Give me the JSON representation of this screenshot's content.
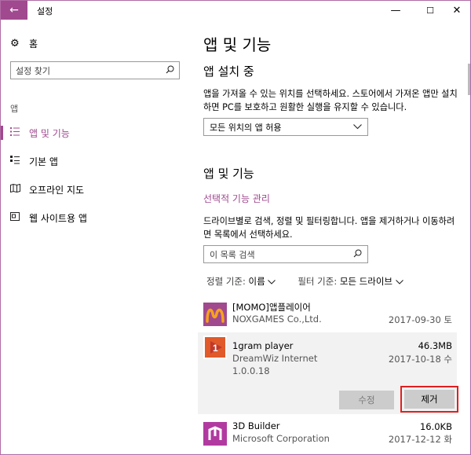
{
  "window": {
    "title": "설정",
    "back_glyph": "←",
    "min_glyph": "—",
    "max_glyph": "☐",
    "close_glyph": "✕"
  },
  "sidebar": {
    "home_label": "홈",
    "search_placeholder": "설정 찾기",
    "section_label": "앱",
    "items": [
      {
        "label": "앱 및 기능",
        "icon": "list-icon",
        "active": true
      },
      {
        "label": "기본 앱",
        "icon": "default-apps-icon",
        "active": false
      },
      {
        "label": "오프라인 지도",
        "icon": "map-icon",
        "active": false
      },
      {
        "label": "웹 사이트용 앱",
        "icon": "website-apps-icon",
        "active": false
      }
    ]
  },
  "main": {
    "title": "앱 및 기능",
    "install_heading": "앱 설치 중",
    "install_desc": "앱을 가져올 수 있는 위치를 선택하세요. 스토어에서 가져온 앱만 설치하면 PC를 보호하고 원활한 실행을 유지할 수 있습니다.",
    "install_dropdown": "모든 위치의 앱 허용",
    "apps_heading": "앱 및 기능",
    "optional_features_link": "선택적 기능 관리",
    "apps_desc": "드라이브별로 검색, 정렬 및 필터링합니다. 앱을 제거하거나 이동하려면 목록에서 선택하세요.",
    "list_search_placeholder": "이 목록 검색",
    "sort_label": "정렬 기준:",
    "sort_value": "이름",
    "filter_label": "필터 기준:",
    "filter_value": "모든 드라이브",
    "apps": [
      {
        "name": "[MOMO]앱플레이어",
        "publisher": "NOXGAMES Co.,Ltd.",
        "size": "",
        "date": "2017-09-30 토",
        "version": ""
      },
      {
        "name": "1gram player",
        "publisher": "DreamWiz Internet",
        "size": "46.3MB",
        "date": "2017-10-18 수",
        "version": "1.0.0.18"
      },
      {
        "name": "3D Builder",
        "publisher": "Microsoft Corporation",
        "size": "16.0KB",
        "date": "2017-12-12 화",
        "version": ""
      }
    ],
    "modify_button": "수정",
    "uninstall_button": "제거"
  },
  "colors": {
    "accent": "#a0498f",
    "highlight_border": "#e02020",
    "momo_icon": "#a0498f",
    "gram_icon": "#e05a2a"
  }
}
